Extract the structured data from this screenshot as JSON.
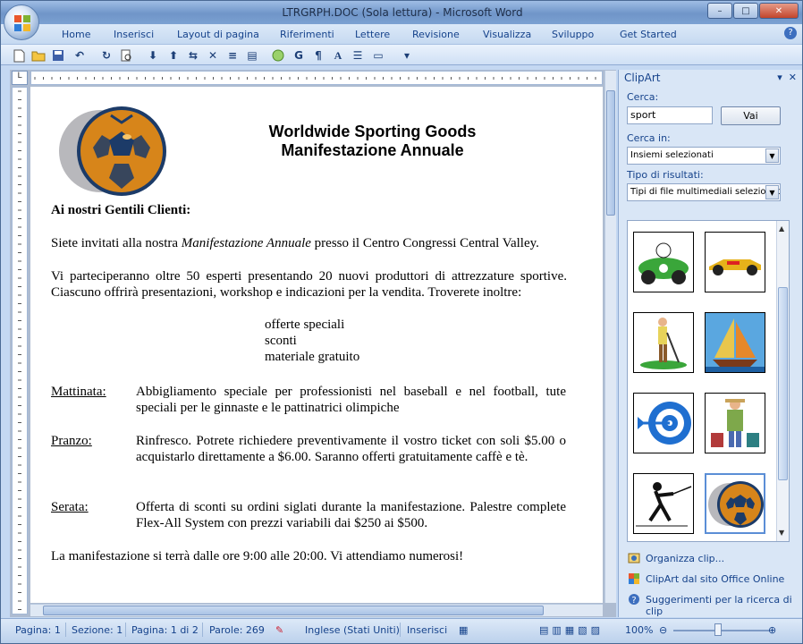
{
  "window": {
    "title": "LTRGRPH.DOC (Sola lettura) - Microsoft Word",
    "controls": {
      "minimize": "–",
      "maximize": "□",
      "close": "✕"
    }
  },
  "ribbon": {
    "tabs": [
      "Home",
      "Inserisci",
      "Layout di pagina",
      "Riferimenti",
      "Lettere",
      "Revisione",
      "Visualizza",
      "Sviluppo",
      "Get Started"
    ],
    "help_icon": "question-icon"
  },
  "toolbar": {
    "icons": [
      "new-doc-icon",
      "open-icon",
      "save-icon",
      "undo-icon",
      "redo-icon",
      "print-preview-icon",
      "move-down-icon",
      "move-up-icon",
      "swap-icon",
      "cut-icon",
      "align-icon",
      "attach-icon",
      "circle-icon",
      "bold-g-icon",
      "pilcrow-icon",
      "font-a-icon",
      "list-icon",
      "chat-icon",
      "more-icon"
    ],
    "bold_label": "G",
    "pilcrow_label": "¶",
    "font_label": "A"
  },
  "document": {
    "title_line1": "Worldwide Sporting Goods",
    "title_line2": "Manifestazione Annuale",
    "greeting": "Ai nostri Gentili Clienti:",
    "p1_before": "Siete invitati alla nostra ",
    "p1_italic": "Manifestazione Annuale",
    "p1_after": " presso il Centro Congressi Central Valley.",
    "p2": "Vi parteciperanno oltre 50 esperti presentando 20 nuovi produttori di attrezzature sportive. Ciascuno offrirà presentazioni, workshop e indicazioni per la vendita. Troverete inoltre:",
    "list": [
      "offerte speciali",
      "sconti",
      "materiale gratuito"
    ],
    "schedule": [
      {
        "label": "Mattinata:",
        "text": "Abbigliamento speciale per professionisti nel baseball e nel football, tute speciali per le ginnaste e le pattinatrici olimpiche"
      },
      {
        "label": "Pranzo:",
        "text": "Rinfresco. Potrete richiedere preventivamente il vostro ticket con soli $5.00 o acquistarlo direttamente a $6.00. Saranno offerti gratuitamente caffè e tè."
      },
      {
        "label": "Serata:",
        "text": "Offerta di sconti su ordini siglati durante la manifestazione. Palestre complete Flex-All System con prezzi variabili  dai $250 ai $500."
      }
    ],
    "closing": "La manifestazione si terrà dalle ore 9:00 alle 20:00. Vi attendiamo numerosi!"
  },
  "clipart_pane": {
    "title": "ClipArt",
    "search_label": "Cerca:",
    "search_value": "sport",
    "go_button": "Vai",
    "search_in_label": "Cerca in:",
    "search_in_value": "Insiemi selezionati",
    "result_type_label": "Tipo di risultati:",
    "result_type_value": "Tipi di file multimediali selezionati",
    "clips": [
      "race-car-driver-clip",
      "formula-car-clip",
      "golfer-clip",
      "sailboat-clip",
      "target-arrow-clip",
      "traveler-clip",
      "fencer-clip",
      "soccer-ball-clip"
    ],
    "links": [
      "Organizza clip...",
      "ClipArt dal sito Office Online",
      "Suggerimenti per la ricerca di clip"
    ]
  },
  "statusbar": {
    "page": "Pagina: 1",
    "section": "Sezione: 1",
    "page_of": "Pagina: 1 di 2",
    "words": "Parole: 269",
    "language": "Inglese (Stati Uniti)",
    "mode": "Inserisci",
    "zoom": "100%"
  },
  "colors": {
    "accent": "#15428b",
    "ribbon": "#c4d8f2",
    "title_bar": "#7ca1d2"
  }
}
